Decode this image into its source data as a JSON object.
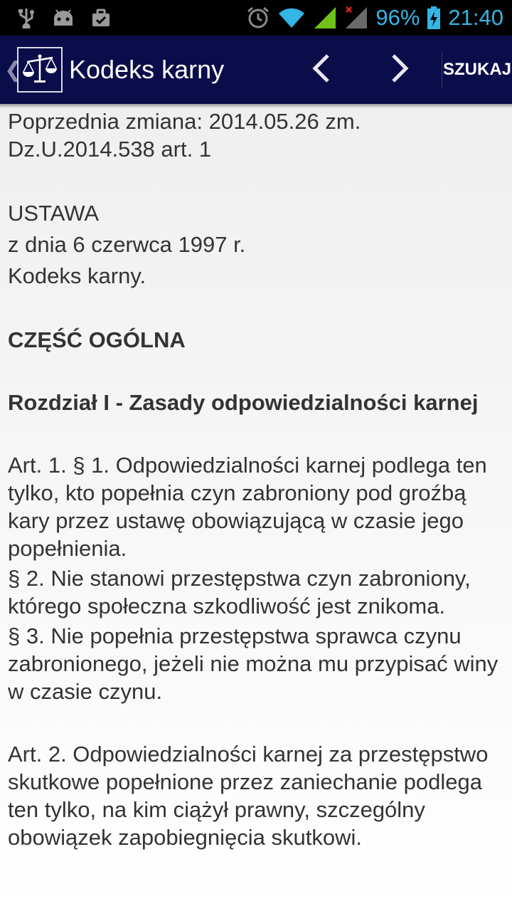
{
  "status_bar": {
    "battery": "96%",
    "time": "21:40",
    "icons": [
      "usb-icon",
      "android-icon",
      "briefcase-icon",
      "alarm-icon",
      "wifi-icon",
      "signal-icon",
      "signal-off-icon",
      "battery-charging-icon"
    ],
    "accent": "#33b5e5"
  },
  "action_bar": {
    "title": "Kodeks karny",
    "search_label": "SZUKAJ",
    "up_indicator": "❮",
    "icons": [
      "scales-icon",
      "prev-arrow-icon",
      "next-arrow-icon"
    ],
    "background": "#0b0c4a"
  },
  "document": {
    "previous_change": "Poprzednia zmiana: 2014.05.26 zm. Dz.U.2014.538  art. 1",
    "act_type": "USTAWA",
    "act_date": "z dnia 6 czerwca 1997 r.",
    "act_title": "Kodeks karny.",
    "part_heading": "CZĘŚĆ OGÓLNA",
    "chapter_heading": "Rozdział I - Zasady odpowiedzialności karnej",
    "articles": [
      {
        "paragraphs": [
          "Art. 1. § 1. Odpowiedzialności karnej podlega ten tylko, kto popełnia czyn zabroniony pod groźbą kary przez ustawę obowiązującą w czasie jego popełnienia.",
          "§ 2. Nie stanowi przestępstwa czyn zabroniony, którego społeczna szkodliwość jest znikoma.",
          "§ 3. Nie popełnia przestępstwa sprawca czynu zabronionego, jeżeli nie można mu przypisać winy w czasie czynu."
        ]
      },
      {
        "paragraphs": [
          "Art. 2. Odpowiedzialności karnej za przestępstwo skutkowe popełnione przez zaniechanie podlega ten tylko, na kim ciążył prawny, szczególny obowiązek zapobiegnięcia skutkowi."
        ]
      }
    ]
  }
}
